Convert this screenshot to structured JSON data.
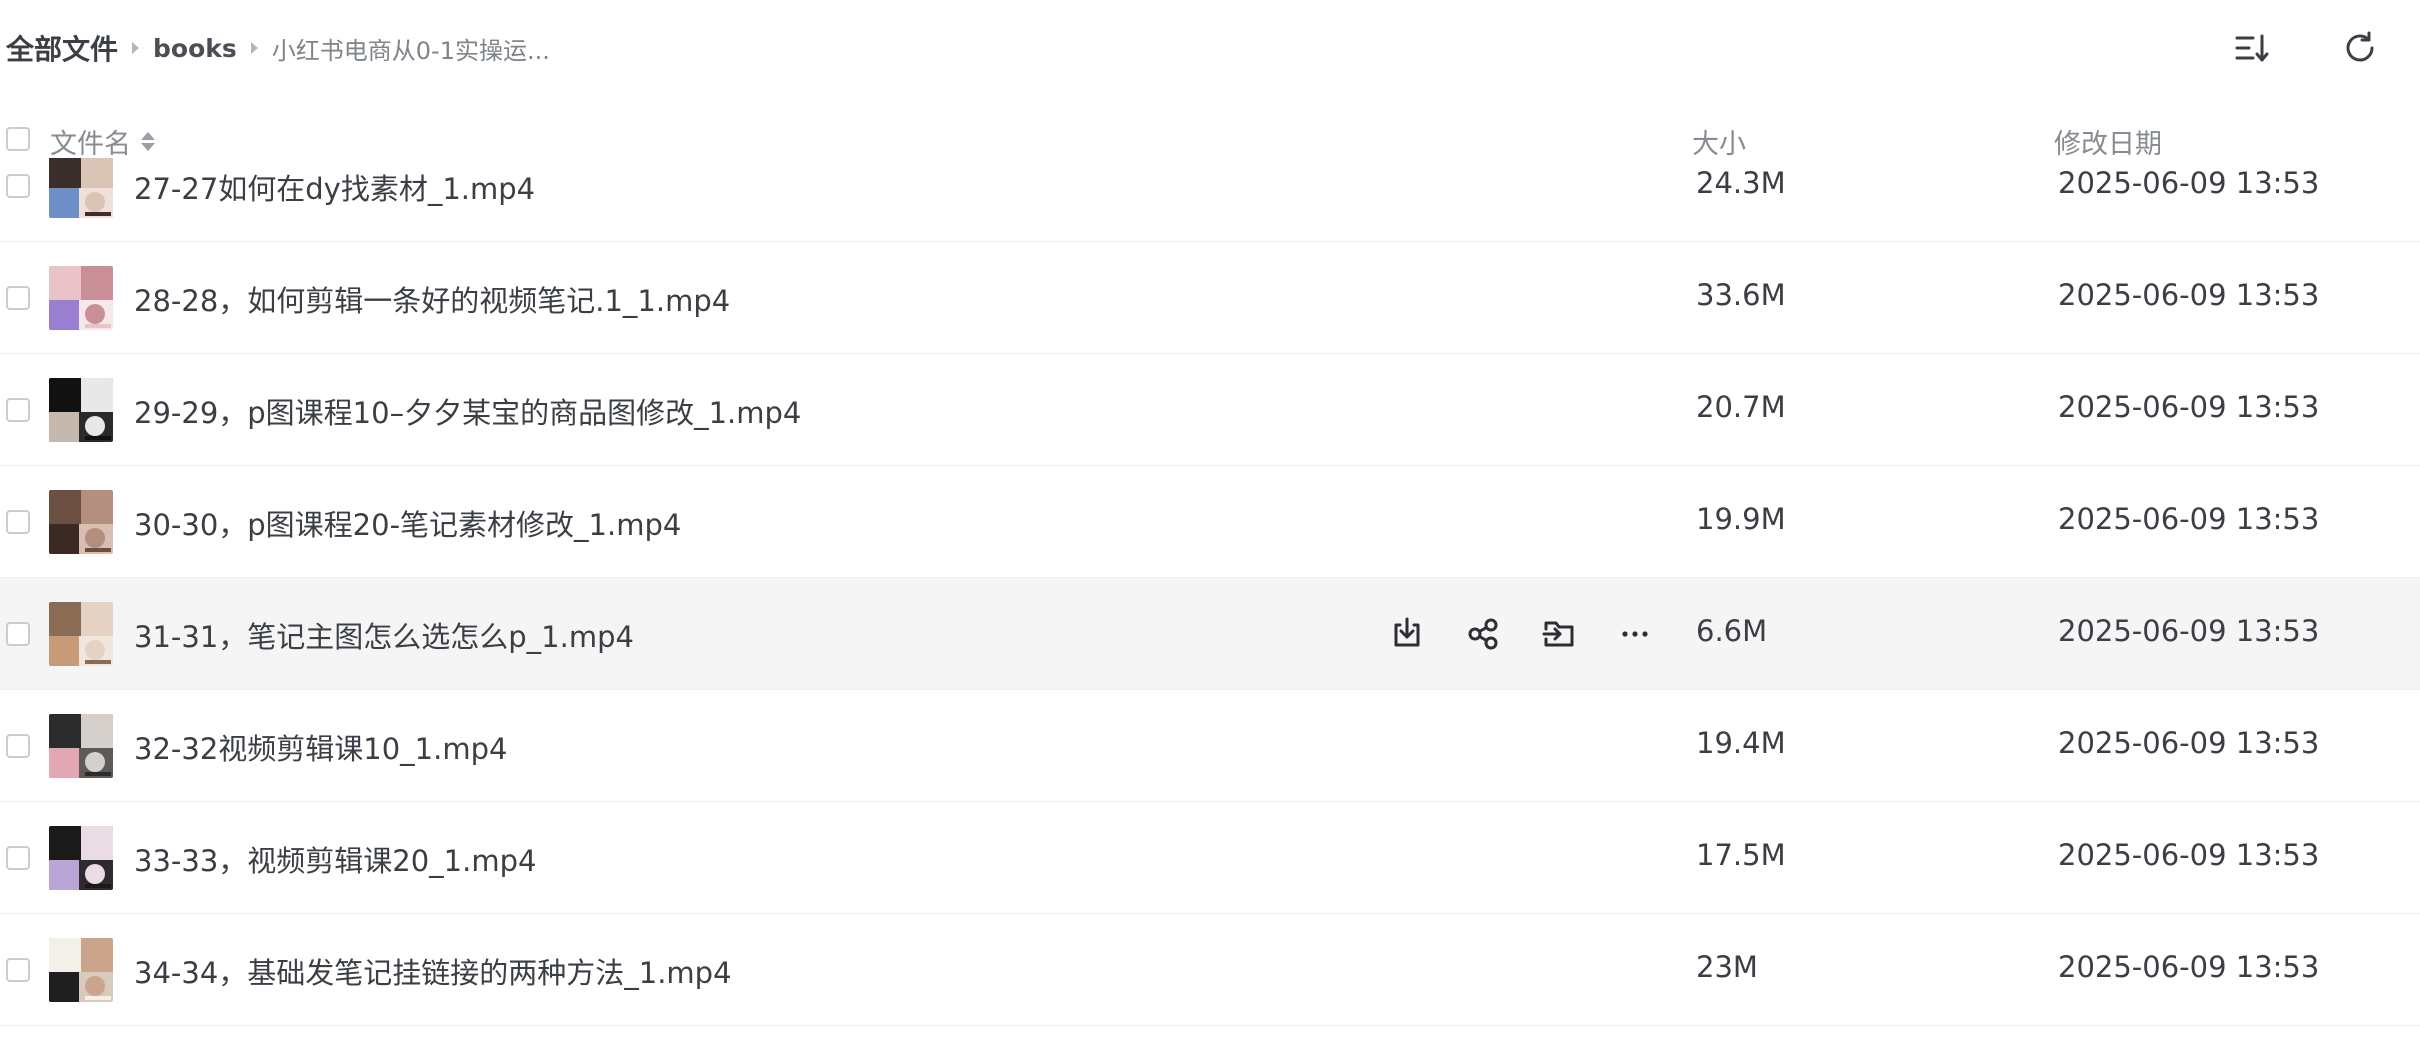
{
  "breadcrumb": {
    "root": "全部文件",
    "parent": "books",
    "current": "小红书电商从0-1实操运..."
  },
  "toolbar": {
    "sort_icon": "list-sort-icon",
    "refresh_icon": "refresh-icon"
  },
  "table": {
    "columns": {
      "name": "文件名",
      "size": "大小",
      "date": "修改日期"
    },
    "rows": [
      {
        "name": "27-27如何在dy找素材_1.mp4",
        "size": "24.3M",
        "date": "2025-06-09 13:53",
        "thumb": [
          "#3a2f2a",
          "#d9c4b6",
          "#6f8fc9",
          "#f1e0d8"
        ]
      },
      {
        "name": "28-28，如何剪辑一条好的视频笔记.1_1.mp4",
        "size": "33.6M",
        "date": "2025-06-09 13:53",
        "thumb": [
          "#e9c3c8",
          "#c98e96",
          "#9a7fd1",
          "#f4e8ea"
        ]
      },
      {
        "name": "29-29，p图课程10–夕夕某宝的商品图修改_1.mp4",
        "size": "20.7M",
        "date": "2025-06-09 13:53",
        "thumb": [
          "#111111",
          "#e8e8e8",
          "#c7b8ad",
          "#2a2a2a"
        ]
      },
      {
        "name": "30-30，p图课程20-笔记素材修改_1.mp4",
        "size": "19.9M",
        "date": "2025-06-09 13:53",
        "thumb": [
          "#6b4f43",
          "#b48f7f",
          "#3b2a24",
          "#d8bfb2"
        ]
      },
      {
        "name": "31-31，笔记主图怎么选怎么p_1.mp4",
        "size": "6.6M",
        "date": "2025-06-09 13:53",
        "thumb": [
          "#8a6b54",
          "#e4d3c5",
          "#c79b77",
          "#f1e6dc"
        ],
        "hover": true
      },
      {
        "name": "32-32视频剪辑课10_1.mp4",
        "size": "19.4M",
        "date": "2025-06-09 13:53",
        "thumb": [
          "#2b2b2b",
          "#d6d0cc",
          "#e3a7b3",
          "#5e5a58"
        ]
      },
      {
        "name": "33-33，视频剪辑课20_1.mp4",
        "size": "17.5M",
        "date": "2025-06-09 13:53",
        "thumb": [
          "#1a1a1a",
          "#e9dce4",
          "#b9a6d6",
          "#2f2a2e"
        ]
      },
      {
        "name": "34-34，基础发笔记挂链接的两种方法_1.mp4",
        "size": "23M",
        "date": "2025-06-09 13:53",
        "thumb": [
          "#f3efe9",
          "#caa58c",
          "#1f1f1f",
          "#d8cbbd"
        ]
      }
    ]
  },
  "row_actions": {
    "download_icon": "download-icon",
    "share_icon": "share-icon",
    "move_icon": "move-icon",
    "more_icon": "more-icon"
  }
}
